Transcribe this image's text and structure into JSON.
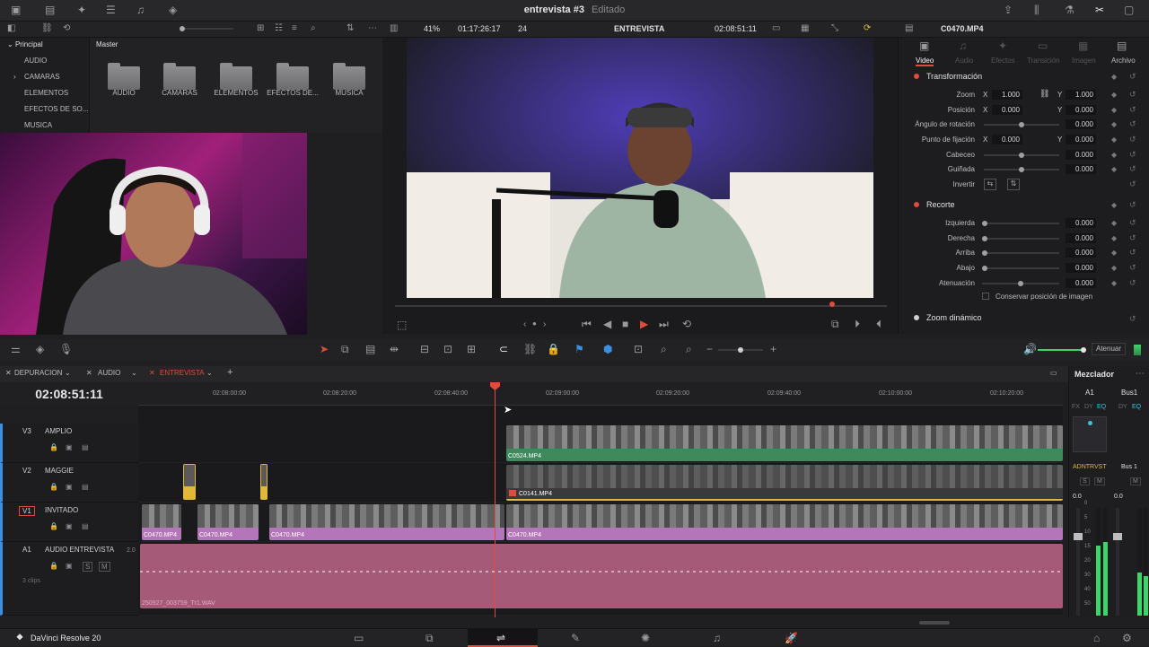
{
  "project": {
    "title": "entrevista #3",
    "status": "Editado"
  },
  "media_pool": {
    "root": "Principal",
    "bins": [
      "AUDIO",
      "CAMARAS",
      "ELEMENTOS",
      "EFECTOS DE SO...",
      "MUSICA"
    ],
    "breadcrumb": "Master",
    "folders": [
      "AUDIO",
      "CAMARAS",
      "ELEMENTOS",
      "EFECTOS DE...",
      "MUSICA"
    ]
  },
  "viewer": {
    "zoom": "41%",
    "source_timecode": "01:17:26:17",
    "frame_rate": "24",
    "timeline_name": "ENTREVISTA",
    "timecode": "02:08:51:11",
    "nav_prev": "‹",
    "nav_next": "›"
  },
  "inspector": {
    "clip_name": "C0470.MP4",
    "tabs": [
      "Video",
      "Audio",
      "Efectos",
      "Transición",
      "Imagen",
      "Archivo"
    ],
    "transform": {
      "title": "Transformación",
      "zoom_label": "Zoom",
      "zoom_x": "1.000",
      "zoom_y": "1.000",
      "pos_label": "Posición",
      "pos_x": "0.000",
      "pos_y": "0.000",
      "rot_label": "Ángulo de rotación",
      "rot_val": "0.000",
      "anchor_label": "Punto de fijación",
      "anchor_x": "0.000",
      "anchor_y": "0.000",
      "pitch_label": "Cabeceo",
      "pitch_val": "0.000",
      "yaw_label": "Guiñada",
      "yaw_val": "0.000",
      "flip_label": "Invertir",
      "x_label": "X",
      "y_label": "Y"
    },
    "crop": {
      "title": "Recorte",
      "left_label": "Izquierda",
      "left_val": "0.000",
      "right_label": "Derecha",
      "right_val": "0.000",
      "top_label": "Arriba",
      "top_val": "0.000",
      "bottom_label": "Abajo",
      "bottom_val": "0.000",
      "soft_label": "Atenuación",
      "soft_val": "0.000",
      "retain_label": "Conservar posición de imagen"
    },
    "dynamic_zoom": "Zoom dinámico"
  },
  "timeline": {
    "tabs": [
      "DEPURACION",
      "AUDIO",
      "ENTREVISTA"
    ],
    "timecode": "02:08:51:11",
    "ruler": [
      "02:08:00:00",
      "02:08:20:00",
      "02:08:40:00",
      "02:09:00:00",
      "02:09:20:00",
      "02:09:40:00",
      "02:10:00:00",
      "02:10:20:00"
    ],
    "tracks": [
      {
        "id": "V3",
        "name": "AMPLIO"
      },
      {
        "id": "V2",
        "name": "MAGGIE"
      },
      {
        "id": "V1",
        "name": "INVITADO"
      },
      {
        "id": "A1",
        "name": "AUDIO ENTREVISTA",
        "channels": "2.0",
        "clips": "3 clips",
        "mute": "M",
        "solo": "S"
      }
    ],
    "clips": {
      "v3": "C0524.MP4",
      "v2": "C0141.MP4",
      "v1a": "C0470.MP4",
      "v1b": "C0470.MP4",
      "v1c": "C0470.MP4",
      "v1d": "C0470.MP4",
      "a1": "250927_003759_Tr1.WAV"
    },
    "duck_label": "Atenuar"
  },
  "mixer": {
    "title": "Mezclador",
    "ch1": "A1",
    "ch2": "Bus1",
    "fx": "FX",
    "dy": "DY",
    "eq": "EQ",
    "ch1_name": "ADNTRVST",
    "ch2_name": "Bus 1",
    "s": "S",
    "m": "M",
    "ch1_level": "0.0",
    "ch2_level": "0.0",
    "scale": [
      "0",
      "5",
      "10",
      "15",
      "20",
      "30",
      "40",
      "50"
    ]
  },
  "app": {
    "name": "DaVinci Resolve 20"
  },
  "colors": {
    "accent": "#e04b3a",
    "v3_clip": "#3f8a5d",
    "v1_clip": "#b476b8",
    "audio_clip": "#a55a78",
    "playhead": "#e04b3a",
    "maggie_marker": "#e0b93a"
  }
}
